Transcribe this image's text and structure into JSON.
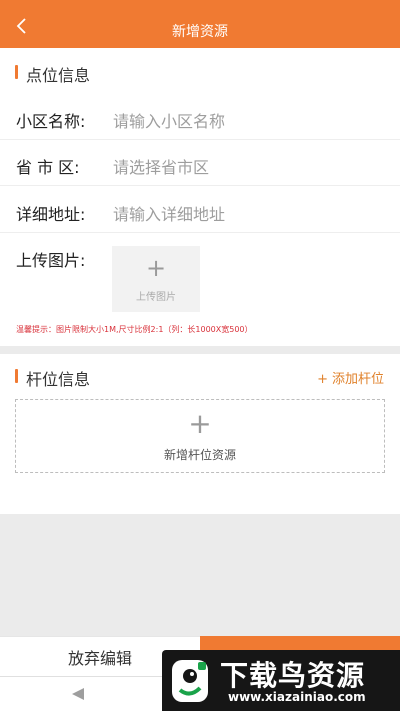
{
  "header": {
    "title": "新增资源"
  },
  "point_section": {
    "title": "点位信息",
    "rows": [
      {
        "label": "小区名称:",
        "placeholder": "请输入小区名称"
      },
      {
        "label": "省 市 区:",
        "placeholder": "请选择省市区"
      },
      {
        "label": "详细地址:",
        "placeholder": "请输入详细地址"
      }
    ],
    "upload_label": "上传图片:",
    "upload_button_text": "上传图片",
    "hint": "温馨提示：图片限制大小1M,尺寸比例2:1（列：长1000X宽500）"
  },
  "pole_section": {
    "title": "杆位信息",
    "add_text": "添加杆位",
    "add_resource_text": "新增杆位资源"
  },
  "footer": {
    "discard_label": "放弃编辑"
  },
  "watermark": {
    "title": "下载鸟资源",
    "url": "www.xiazainiao.com"
  },
  "colors": {
    "accent": "#f07a32",
    "hint": "#d9323b",
    "link": "#e0822c"
  }
}
